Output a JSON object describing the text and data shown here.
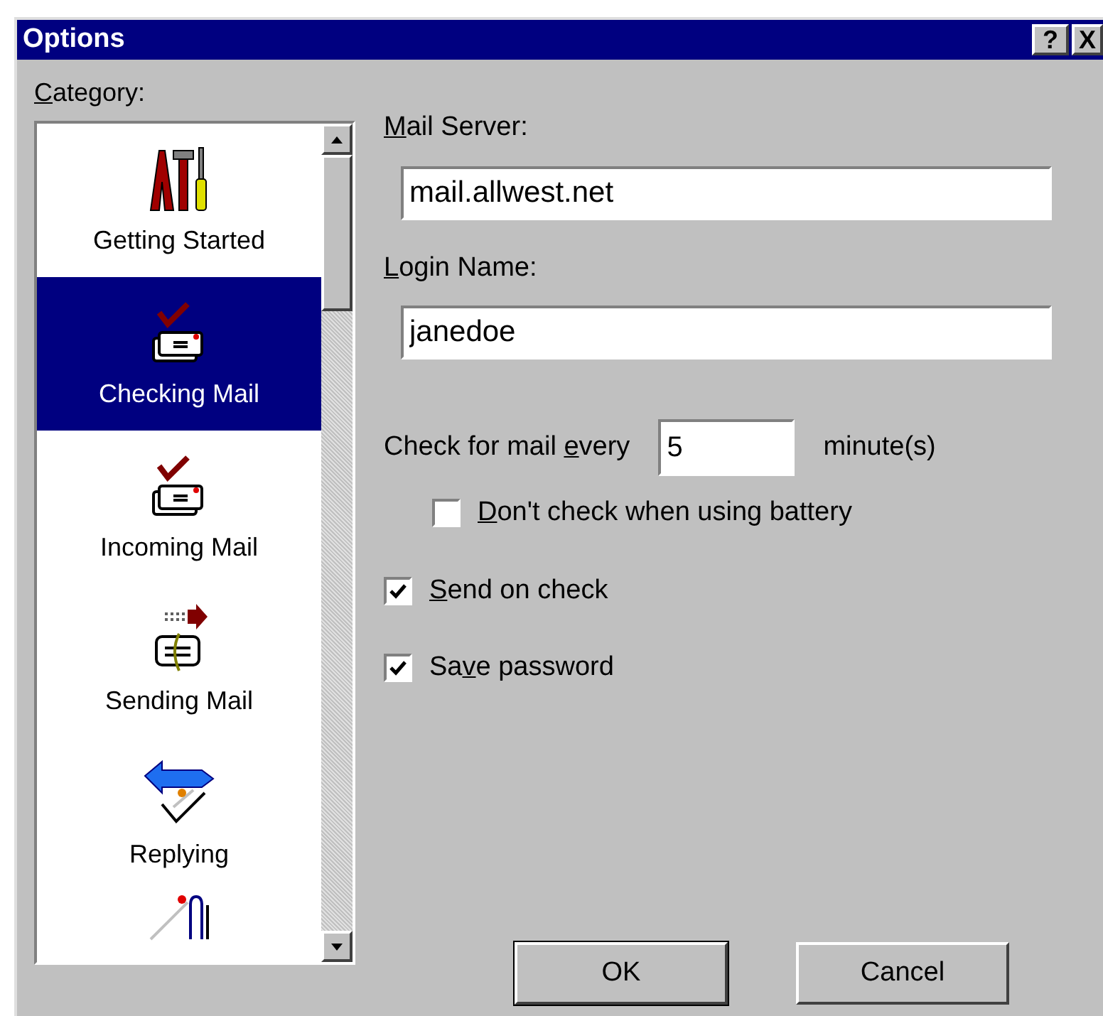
{
  "window": {
    "title": "Options",
    "help_button": "?",
    "close_button": "X"
  },
  "category": {
    "label": {
      "key": "C",
      "post": "ategory:"
    },
    "items": [
      {
        "label": "Getting Started",
        "selected": false
      },
      {
        "label": "Checking Mail",
        "selected": true
      },
      {
        "label": "Incoming Mail",
        "selected": false
      },
      {
        "label": "Sending Mail",
        "selected": false
      },
      {
        "label": "Replying",
        "selected": false
      },
      {
        "selected": false
      }
    ]
  },
  "mail_server": {
    "label": {
      "key": "M",
      "post": "ail Server:"
    },
    "value": "mail.allwest.net"
  },
  "login_name": {
    "label": {
      "key": "L",
      "post": "ogin Name:"
    },
    "value": "janedoe"
  },
  "check_interval": {
    "label": {
      "pre": "Check for mail ",
      "key": "e",
      "post": "very"
    },
    "value": "5",
    "unit": "minute(s)"
  },
  "options": [
    {
      "label": {
        "key": "D",
        "post": "on't check when using battery"
      },
      "checked": false,
      "indented": true
    },
    {
      "label": {
        "key": "S",
        "post": "end on check"
      },
      "checked": true,
      "indented": false
    },
    {
      "label": {
        "pre": "Sa",
        "key": "v",
        "post": "e password"
      },
      "checked": true,
      "indented": false
    }
  ],
  "buttons": [
    "OK",
    "Cancel"
  ]
}
